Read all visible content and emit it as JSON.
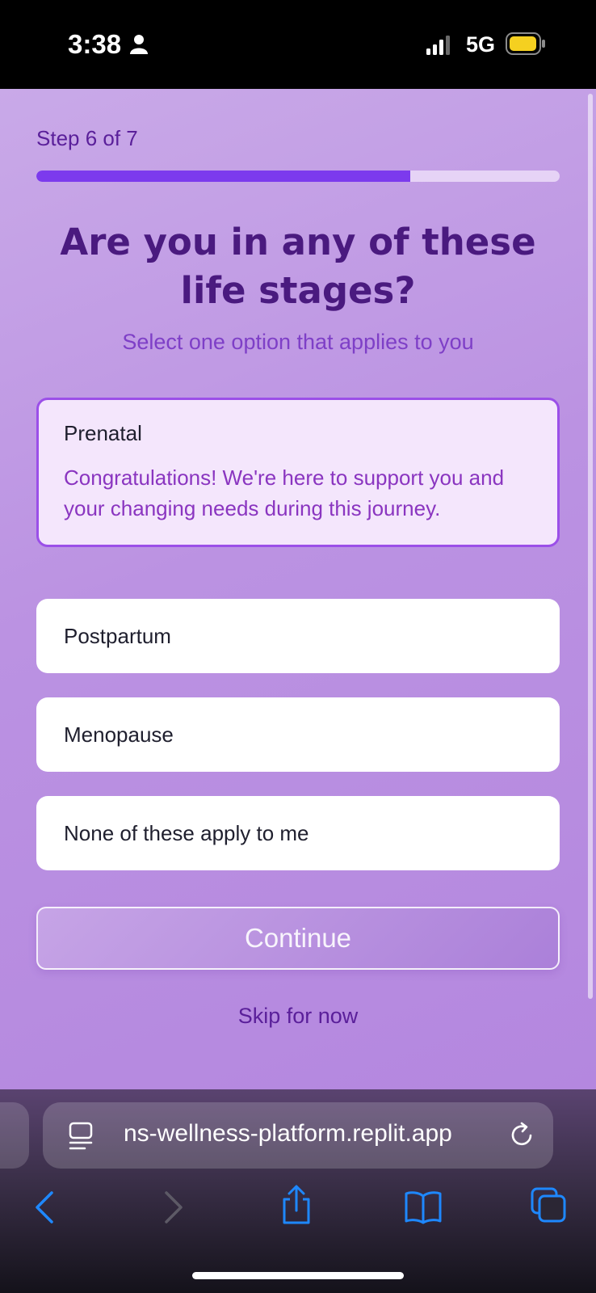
{
  "status_bar": {
    "time": "3:38",
    "network": "5G",
    "icons": [
      "person-icon",
      "signal-icon",
      "battery-icon"
    ],
    "battery_color": "#f5d020"
  },
  "onboarding": {
    "step_label": "Step 6 of 7",
    "progress": {
      "current": 6,
      "total": 7,
      "fill_fraction": 0.714
    },
    "title": "Are you in any of these life stages?",
    "subtitle": "Select one option that applies to you",
    "options": [
      {
        "label": "Prenatal",
        "description": "Congratulations! We're here to support you and your changing needs during this journey.",
        "selected": true
      },
      {
        "label": "Postpartum",
        "selected": false
      },
      {
        "label": "Menopause",
        "selected": false
      },
      {
        "label": "None of these apply to me",
        "selected": false
      }
    ],
    "continue_label": "Continue",
    "skip_label": "Skip for now"
  },
  "browser": {
    "url": "ns-wellness-platform.replit.app",
    "toolbar_icons": [
      "back-icon",
      "forward-icon",
      "share-icon",
      "bookmarks-icon",
      "tabs-icon"
    ]
  },
  "colors": {
    "accent": "#7c3aed",
    "title": "#4a1a7f",
    "background": "#bb92e2",
    "selected_border": "#9b4fe8",
    "browser_tint": "#1e88ff"
  }
}
